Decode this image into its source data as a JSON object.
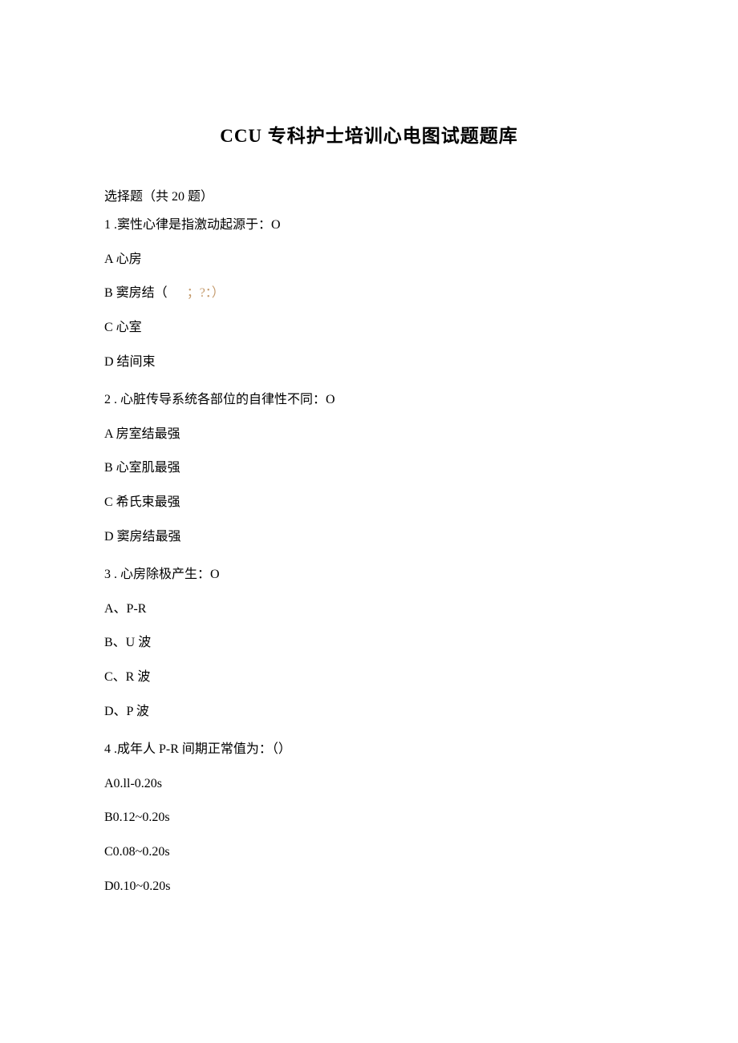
{
  "title": "CCU 专科护士培训心电图试题题库",
  "section": "选择题（共 20 题）",
  "questions": [
    {
      "number": "1",
      "text": " .窦性心律是指激动起源于：O",
      "options": [
        {
          "label": "A 心房",
          "annotation": ""
        },
        {
          "label": "B 窦房结（",
          "annotation": "；?：）"
        },
        {
          "label": "C 心室",
          "annotation": ""
        },
        {
          "label": "D 结间束",
          "annotation": ""
        }
      ]
    },
    {
      "number": "2",
      "text": "   . 心脏传导系统各部位的自律性不同：O",
      "options": [
        {
          "label": "A 房室结最强",
          "annotation": ""
        },
        {
          "label": "B 心室肌最强",
          "annotation": ""
        },
        {
          "label": "C 希氏束最强",
          "annotation": ""
        },
        {
          "label": "D 窦房结最强",
          "annotation": ""
        }
      ]
    },
    {
      "number": "3",
      "text": "   . 心房除极产生：O",
      "options": [
        {
          "label": "A、P-R",
          "annotation": ""
        },
        {
          "label": "B、U 波",
          "annotation": ""
        },
        {
          "label": "C、R 波",
          "annotation": ""
        },
        {
          "label": "D、P 波",
          "annotation": ""
        }
      ]
    },
    {
      "number": "4",
      "text": "   .成年人 P-R 间期正常值为：（）",
      "options": [
        {
          "label": "A0.ll-0.20s",
          "annotation": ""
        },
        {
          "label": "B0.12~0.20s",
          "annotation": ""
        },
        {
          "label": "C0.08~0.20s",
          "annotation": ""
        },
        {
          "label": "D0.10~0.20s",
          "annotation": ""
        }
      ]
    }
  ]
}
